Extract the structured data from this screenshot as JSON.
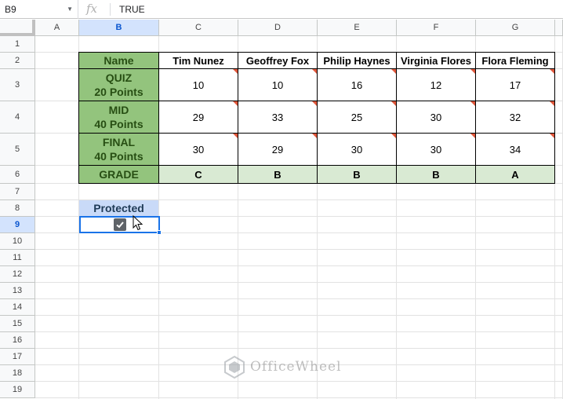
{
  "formula_bar": {
    "cell_ref": "B9",
    "fx_label": "fx",
    "value": "TRUE"
  },
  "columns": [
    "A",
    "B",
    "C",
    "D",
    "E",
    "F",
    "G"
  ],
  "selected_column": "B",
  "rows": [
    "1",
    "2",
    "3",
    "4",
    "5",
    "6",
    "7",
    "8",
    "9",
    "10",
    "11",
    "12",
    "13",
    "14",
    "15",
    "16",
    "17",
    "18",
    "19"
  ],
  "selected_row": "9",
  "table": {
    "header_label": "Name",
    "students": [
      "Tim Nunez",
      "Geoffrey Fox",
      "Philip Haynes",
      "Virginia Flores",
      "Flora Fleming"
    ],
    "rows": [
      {
        "label_line1": "QUIZ",
        "label_line2": "20 Points",
        "values": [
          "10",
          "10",
          "16",
          "12",
          "17"
        ]
      },
      {
        "label_line1": "MID",
        "label_line2": "40 Points",
        "values": [
          "29",
          "33",
          "25",
          "30",
          "32"
        ]
      },
      {
        "label_line1": "FINAL",
        "label_line2": "40 Points",
        "values": [
          "30",
          "29",
          "30",
          "30",
          "34"
        ]
      }
    ],
    "grade_label": "GRADE",
    "grades": [
      "C",
      "B",
      "B",
      "B",
      "A"
    ]
  },
  "protected": {
    "label": "Protected",
    "checked": true
  },
  "colors": {
    "header_green": "#93c47d",
    "light_green": "#d9ead3",
    "protected_blue": "#c9daf8",
    "selection_blue": "#1a73e8",
    "note_triangle": "#e0573b"
  },
  "watermark": {
    "text": "OfficeWheel"
  }
}
